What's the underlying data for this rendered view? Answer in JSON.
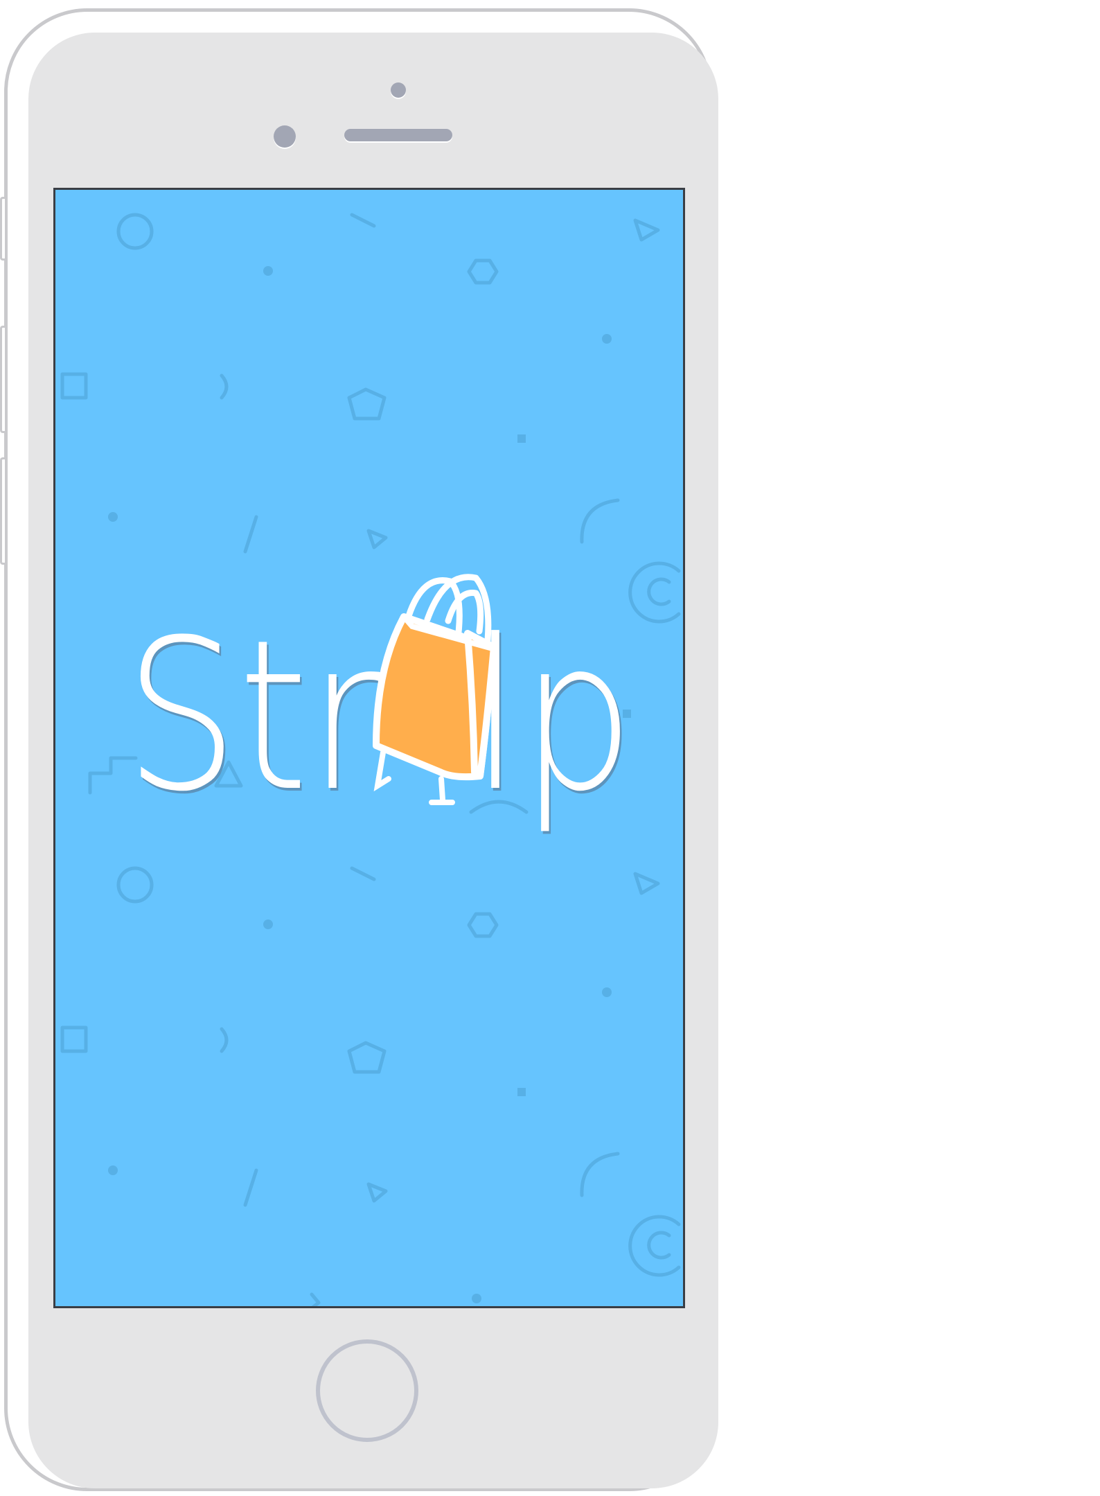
{
  "app": {
    "name_left": "Str",
    "name_right": "lp",
    "background_color": "#66c4fe",
    "accent_color": "#ffae4c"
  },
  "device": {
    "frame_color": "#e5e5e6",
    "screen_border_color": "#3a3e45"
  },
  "icons": {
    "logo_bag": "shopping-bag-icon",
    "camera": "front-camera-icon",
    "home": "home-button-icon"
  }
}
